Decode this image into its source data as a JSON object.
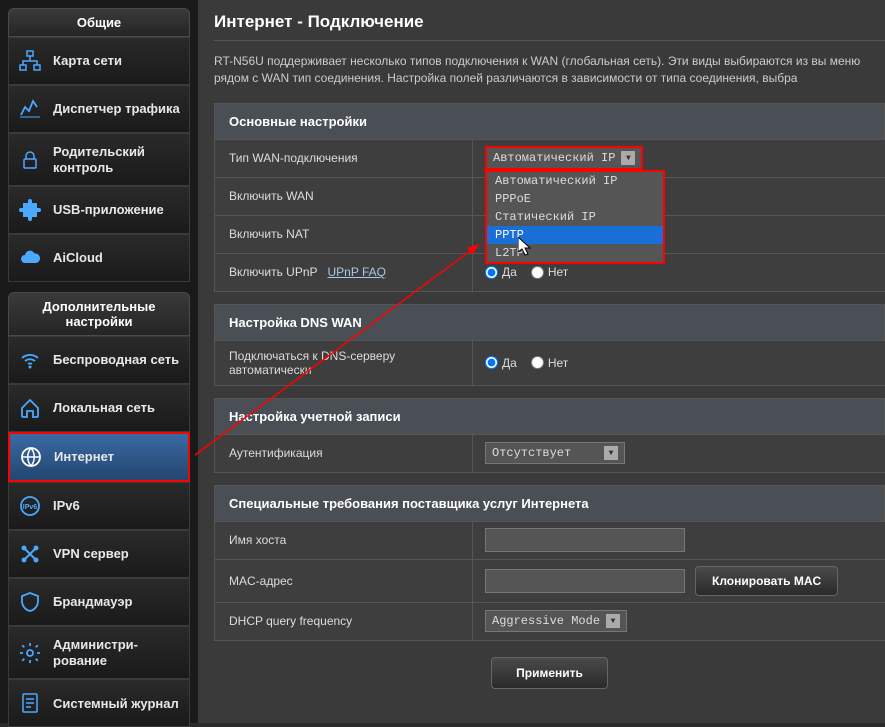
{
  "sidebar": {
    "general_header": "Общие",
    "advanced_header": "Дополнительные настройки",
    "general_items": [
      {
        "label": "Карта сети",
        "icon": "network-map"
      },
      {
        "label": "Диспетчер трафика",
        "icon": "traffic"
      },
      {
        "label": "Родительский контроль",
        "icon": "lock"
      },
      {
        "label": "USB-приложение",
        "icon": "puzzle"
      },
      {
        "label": "AiCloud",
        "icon": "cloud"
      }
    ],
    "advanced_items": [
      {
        "label": "Беспроводная сеть",
        "icon": "wifi"
      },
      {
        "label": "Локальная сеть",
        "icon": "home"
      },
      {
        "label": "Интернет",
        "icon": "globe",
        "active": true
      },
      {
        "label": "IPv6",
        "icon": "ipv6"
      },
      {
        "label": "VPN сервер",
        "icon": "vpn"
      },
      {
        "label": "Брандмауэр",
        "icon": "shield"
      },
      {
        "label": "Администри-рование",
        "icon": "admin"
      },
      {
        "label": "Системный журнал",
        "icon": "log"
      }
    ]
  },
  "main": {
    "title": "Интернет - Подключение",
    "description": "RT-N56U поддерживает несколько типов подключения к WAN (глобальная сеть). Эти виды выбираются из вы меню рядом с WAN тип соединения. Настройка полей различаются в зависимости от типа соединения, выбра",
    "sections": {
      "basic": {
        "header": "Основные настройки",
        "wan_type_label": "Тип WAN-подключения",
        "wan_type_value": "Автоматический IP",
        "wan_type_options": [
          "Автоматический IP",
          "PPPoE",
          "Статический IP",
          "PPTP",
          "L2TP"
        ],
        "enable_wan_label": "Включить WAN",
        "enable_nat_label": "Включить NAT",
        "enable_upnp_label": "Включить UPnP",
        "upnp_faq": "UPnP FAQ",
        "yes": "Да",
        "no": "Нет"
      },
      "dns": {
        "header": "Настройка DNS WAN",
        "auto_dns_label": "Подключаться к DNS-серверу автоматически"
      },
      "account": {
        "header": "Настройка учетной записи",
        "auth_label": "Аутентификация",
        "auth_value": "Отсутствует"
      },
      "isp": {
        "header": "Специальные требования поставщика услуг Интернета",
        "hostname_label": "Имя хоста",
        "mac_label": "MAC-адрес",
        "clone_mac_button": "Клонировать MAC",
        "dhcp_label": "DHCP query frequency",
        "dhcp_value": "Aggressive Mode"
      }
    },
    "apply_button": "Применить"
  }
}
